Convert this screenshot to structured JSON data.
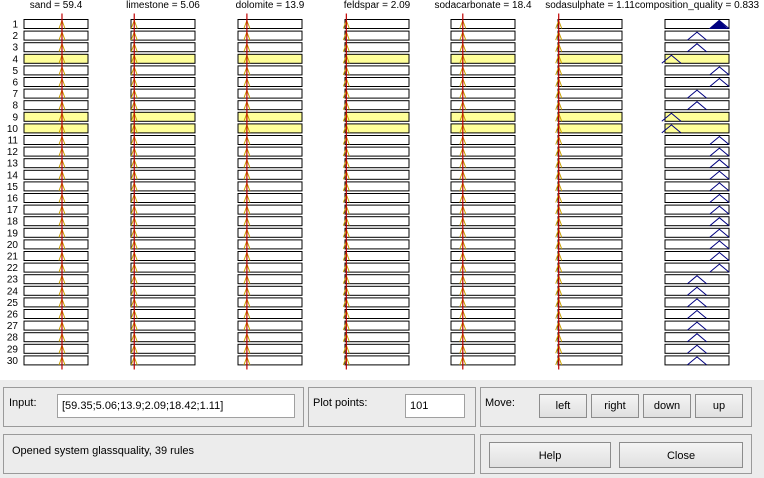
{
  "variables": [
    {
      "title": "sand = 59.4",
      "marker": 59.35,
      "range": [
        0,
        100
      ]
    },
    {
      "title": "limestone = 5.06",
      "marker": 5.06,
      "range": [
        0,
        100
      ]
    },
    {
      "title": "dolomite = 13.9",
      "marker": 13.9,
      "range": [
        0,
        100
      ]
    },
    {
      "title": "feldspar = 2.09",
      "marker": 2.09,
      "range": [
        0,
        100
      ]
    },
    {
      "title": "sodacarbonate = 18.4",
      "marker": 18.42,
      "range": [
        0,
        100
      ]
    },
    {
      "title": "sodasulphate = 1.11",
      "marker": 1.11,
      "range": [
        0,
        100
      ]
    },
    {
      "title": "composition_quality = 0.833",
      "marker": null,
      "range": [
        0,
        1
      ]
    }
  ],
  "rule_numbers": [
    "1",
    "2",
    "3",
    "4",
    "5",
    "6",
    "7",
    "8",
    "9",
    "10",
    "11",
    "12",
    "13",
    "14",
    "15",
    "16",
    "17",
    "18",
    "19",
    "20",
    "21",
    "22",
    "23",
    "24",
    "25",
    "26",
    "27",
    "28",
    "29",
    "30"
  ],
  "highlighted_rules": [
    4,
    9,
    10
  ],
  "output_peaks": [
    0.85,
    0.5,
    0.5,
    0.1,
    0.85,
    0.85,
    0.5,
    0.5,
    0.1,
    0.1,
    0.85,
    0.85,
    0.85,
    0.85,
    0.85,
    0.85,
    0.85,
    0.85,
    0.85,
    0.85,
    0.85,
    0.85,
    0.5,
    0.5,
    0.5,
    0.5,
    0.5,
    0.5,
    0.5,
    0.5
  ],
  "input": {
    "label": "Input:",
    "value": "[59.35;5.06;13.9;2.09;18.42;1.11]"
  },
  "plot_points": {
    "label": "Plot points:",
    "value": "101"
  },
  "move": {
    "label": "Move:",
    "left": "left",
    "right": "right",
    "down": "down",
    "up": "up"
  },
  "status": "Opened system glassquality, 39 rules",
  "buttons": {
    "help": "Help",
    "close": "Close"
  },
  "colors": {
    "marker": "#c00000",
    "highlight": "#ffff99",
    "membership": "#c8a000",
    "output": "#000080"
  }
}
